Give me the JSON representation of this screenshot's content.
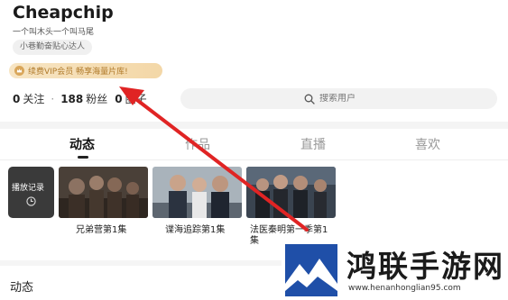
{
  "profile": {
    "username": "Cheapchip",
    "bio": "一个叫木头一个叫马尾",
    "tag": "小巷勤奋贴心达人"
  },
  "vip": {
    "text": "续费VIP会员 畅享海量片库!",
    "icon": "crown-icon"
  },
  "stats": {
    "following_count": "0",
    "following_label": "关注",
    "fans_count": "188",
    "fans_label": "粉丝",
    "circle_count": "0",
    "circle_label": "圈子"
  },
  "search": {
    "placeholder": "搜索用户",
    "icon": "search-icon"
  },
  "tabs": [
    {
      "label": "动态",
      "active": true
    },
    {
      "label": "作品",
      "active": false
    },
    {
      "label": "直播",
      "active": false
    },
    {
      "label": "喜欢",
      "active": false
    }
  ],
  "history": {
    "label": "播放记录",
    "icon": "clock-icon"
  },
  "videos": [
    {
      "caption": "兄弟营第1集"
    },
    {
      "caption": "谍海追踪第1集"
    },
    {
      "caption": "法医秦明第一季第1集"
    }
  ],
  "section": {
    "title": "动态"
  },
  "watermark": {
    "title": "鸿联手游网",
    "url": "www.henanhonglian95.com"
  },
  "colors": {
    "accent_vip": "#b07a2a",
    "arrow": "#e02424",
    "background": "#ffffff"
  }
}
